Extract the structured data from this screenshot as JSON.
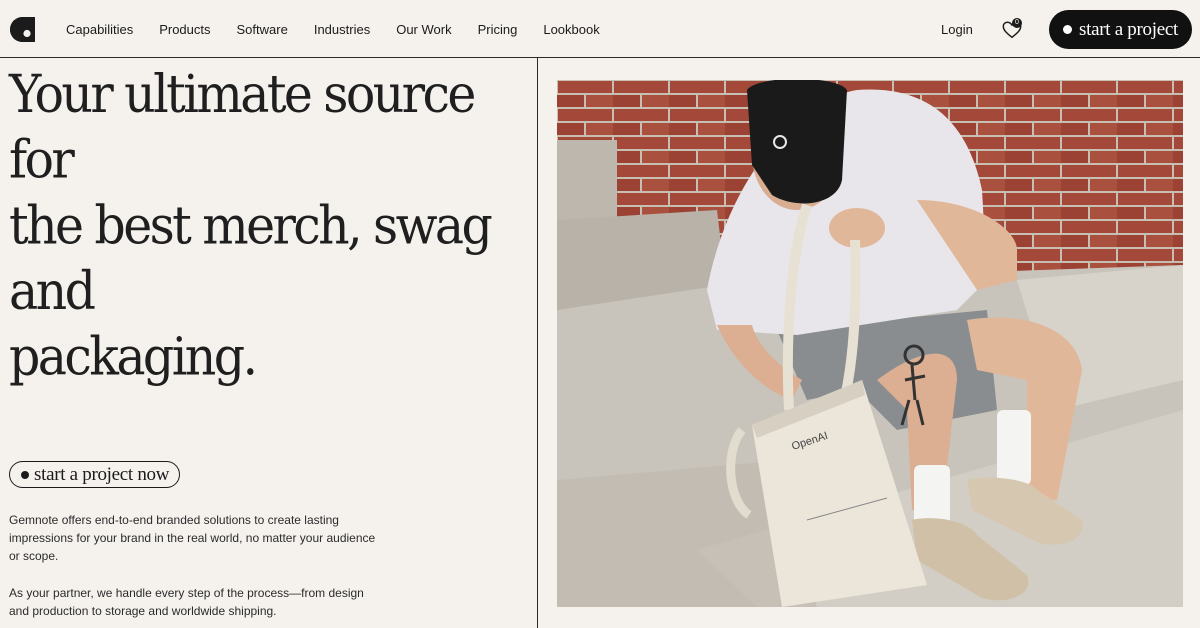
{
  "nav": {
    "links": [
      "Capabilities",
      "Products",
      "Software",
      "Industries",
      "Our Work",
      "Pricing",
      "Lookbook"
    ],
    "login": "Login",
    "favorites_count": "0",
    "cta": "start a project"
  },
  "hero": {
    "headline_line1": "Your ultimate source for",
    "headline_line2": "the best merch, swag and",
    "headline_line3": "packaging.",
    "cta": "start a project now",
    "paragraph1": "Gemnote offers end-to-end branded solutions to create lasting impressions for your brand in the real world, no matter your audience or scope.",
    "paragraph2": "As your partner, we handle every step of the process—from design and production to storage and worldwide shipping.",
    "image_brand_text": "OpenAI"
  },
  "icons": {
    "logo": "gemnote-logo-icon",
    "favorites": "heart-icon"
  },
  "colors": {
    "background": "#f5f2ee",
    "text": "#1b1b1b",
    "button_dark": "#111111",
    "brick": "#a4493a",
    "pavement": "#c9c4bb"
  }
}
